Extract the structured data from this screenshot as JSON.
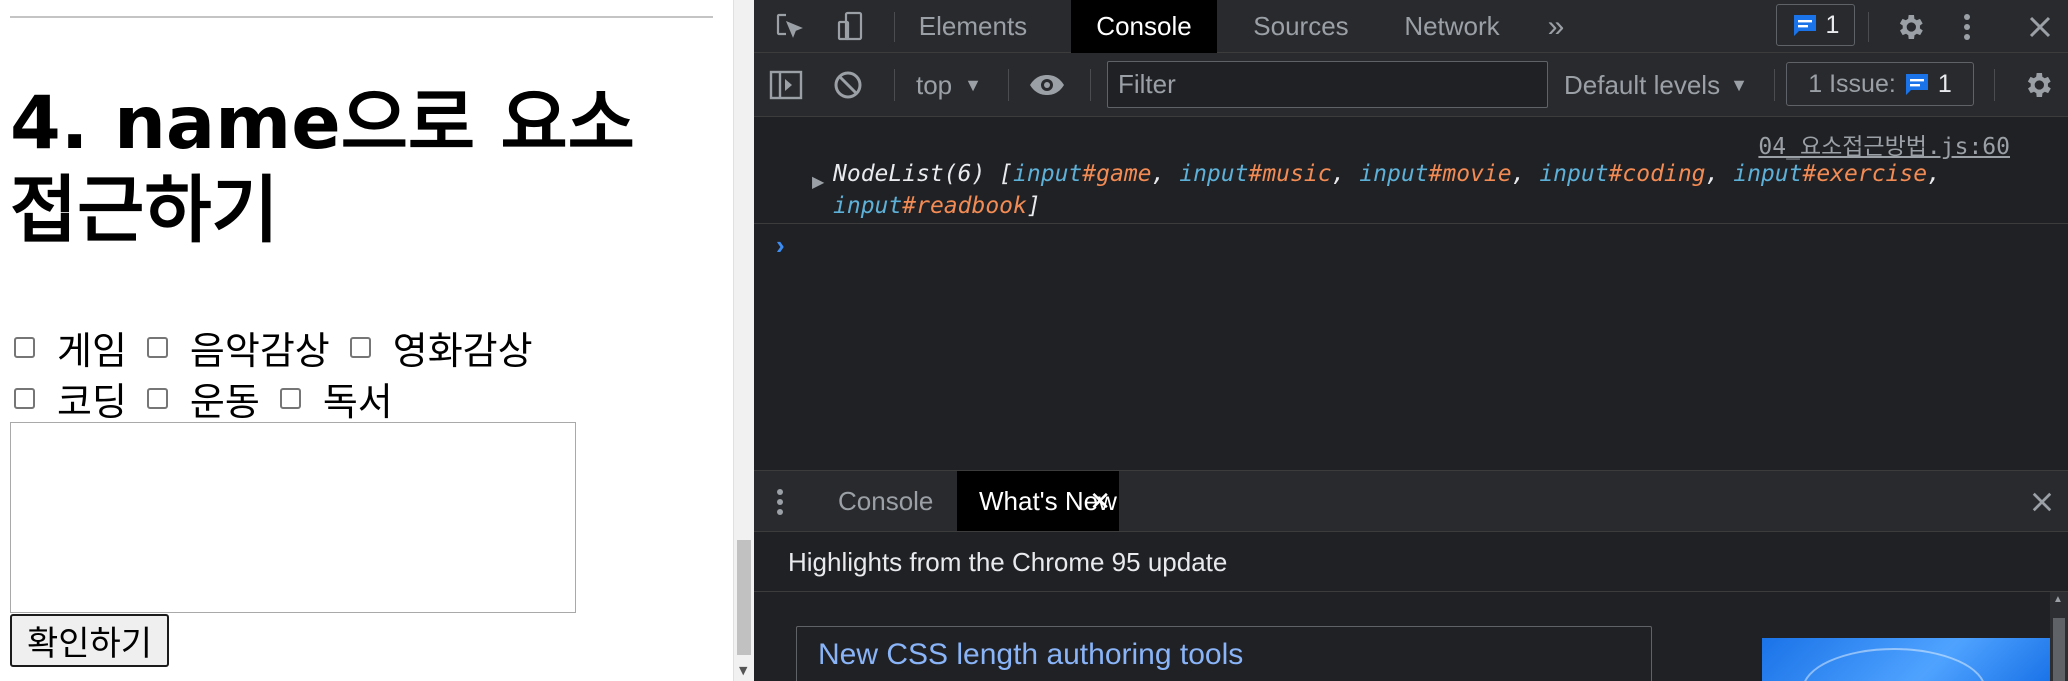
{
  "page": {
    "title": "4. name으로 요소 접근하기",
    "checkbox_row1": [
      "게임",
      "음악감상",
      "영화감상"
    ],
    "checkbox_row2": [
      "코딩",
      "운동",
      "독서"
    ],
    "button_label": "확인하기"
  },
  "devtools": {
    "tabs": [
      "Elements",
      "Console",
      "Sources",
      "Network"
    ],
    "active_tab": "Console",
    "more_tabs_glyph": "»",
    "messages_badge": "1",
    "toolbar": {
      "context": "top",
      "filter_placeholder": "Filter",
      "levels": "Default levels",
      "issues_label": "1 Issue:",
      "issues_count": "1"
    },
    "console": {
      "source_link": "04_요소접근방법.js:60",
      "nodelist_prefix": "NodeList(6)",
      "nodes": [
        {
          "tag": "input",
          "id": "#game"
        },
        {
          "tag": "input",
          "id": "#music"
        },
        {
          "tag": "input",
          "id": "#movie"
        },
        {
          "tag": "input",
          "id": "#coding"
        },
        {
          "tag": "input",
          "id": "#exercise"
        },
        {
          "tag": "input",
          "id": "#readbook"
        }
      ],
      "prompt": "›"
    },
    "drawer": {
      "tabs": [
        "Console",
        "What's New"
      ],
      "active_tab": "What's New",
      "heading": "Highlights from the Chrome 95 update",
      "article_title": "New CSS length authoring tools"
    }
  },
  "colors": {
    "devtools_bg": "#202124",
    "toolbar_bg": "#292a2d",
    "tag_color": "#5db0d7",
    "id_color": "#f28b54",
    "link_blue": "#8ab4f8",
    "prompt_blue": "#3c8cf2"
  },
  "icons": [
    "inspect-icon",
    "device-toggle-icon",
    "chat-icon",
    "gear-icon",
    "kebab-menu-icon",
    "close-icon",
    "sidebar-toggle-icon",
    "clear-console-icon",
    "caret-down-icon",
    "eye-icon",
    "expand-arrow-icon",
    "drawer-menu-icon"
  ]
}
